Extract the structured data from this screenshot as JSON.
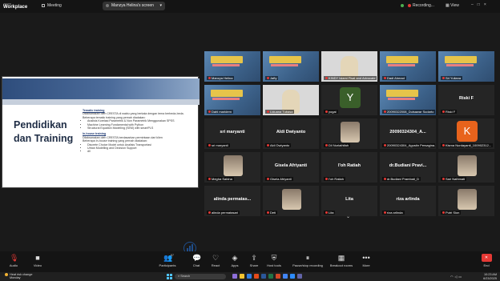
{
  "app": {
    "brand_small": "zoom",
    "brand_big": "Workplace",
    "meeting_label": "Meeting"
  },
  "sharing_banner": "Manzya Helina's screen",
  "recording_label": "Recording...",
  "view_label": "View",
  "slide": {
    "title_line1": "Pendidikan",
    "title_line2": "dan Training",
    "sections": [
      {
        "heading": "Tematic training",
        "intro": "Dilaksanakan oleh CRESTA di waktu yang berkala dengan tema berbeda-beda.",
        "intro2": "Beberapa tematic training yang pernah diadakan:",
        "items": [
          "Analisis Korelasi Parametrik & Non Parametrik Menggunakan SPSS",
          "Machine Learning Fundamental with Python",
          "Structural Equation Modelling (SEM) with smartPLS"
        ]
      },
      {
        "heading": "In-house training",
        "intro": "Dilaksanakan oleh CRESTA berdasarkan permintaan dari klien",
        "intro2": "Beberapa In-house training yang pernah diadakan:",
        "items": [
          "Discrete Choice Model untuk Analisis Transportasi",
          "Urban Modelling and Decision Support",
          "dll"
        ]
      }
    ],
    "logo_text": "CRESTA"
  },
  "participants": [
    {
      "name": "Manzya Helina",
      "kind": "poster"
    },
    {
      "name": "Jafty",
      "kind": "poster"
    },
    {
      "name": "KINDY Islami Fisal and Advocate",
      "kind": "face"
    },
    {
      "name": "Dadi Ahmad",
      "kind": "poster"
    },
    {
      "name": "Sri Yuliana",
      "kind": "poster"
    },
    {
      "name": "Dahl maridem",
      "kind": "poster"
    },
    {
      "name": "Liduana Tubasa",
      "kind": "face"
    },
    {
      "name": "yogai",
      "kind": "avatar",
      "avatar": "Y",
      "avatar_color": "y"
    },
    {
      "name": "20090322008_Dulsawar Sudarto",
      "kind": "poster"
    },
    {
      "name": "Riski F",
      "kind": "text",
      "big": "Riski F"
    },
    {
      "name": "sri maryanti",
      "kind": "text",
      "big": "sri maryanti"
    },
    {
      "name": "Aldi Dwiyanto",
      "kind": "text",
      "big": "Aldi Dwiyanto"
    },
    {
      "name": "Dil Nurlathifah",
      "kind": "pic"
    },
    {
      "name": "20090324304_Agustin Persagina...",
      "kind": "text",
      "big": "20090324304_A..."
    },
    {
      "name": "Kisma Nurdayanti_100902312...",
      "kind": "avatar",
      "avatar": "K",
      "avatar_color": "k"
    },
    {
      "name": "Megha Sabina",
      "kind": "pic"
    },
    {
      "name": "Gisela Afriyanti",
      "kind": "text",
      "big": "Gisela Afriyanti"
    },
    {
      "name": "I'oh Ratiah",
      "kind": "text",
      "big": "I'oh Ratiah"
    },
    {
      "name": "dr.Budiani Prambati_D",
      "kind": "text",
      "big": "dr.Budiani Pravi..."
    },
    {
      "name": "Sari Nathmati",
      "kind": "pic"
    },
    {
      "name": "alinda permatasari",
      "kind": "text",
      "big": "alinda permatas..."
    },
    {
      "name": "Deti",
      "kind": "pic"
    },
    {
      "name": "Lita",
      "kind": "text",
      "big": "Lita"
    },
    {
      "name": "riza arlinda",
      "kind": "text",
      "big": "riza arlinda"
    },
    {
      "name": "Putri Sion",
      "kind": "pic"
    }
  ],
  "toolbar": {
    "audio": "Audio",
    "video": "Video",
    "participants": "Participants",
    "participants_count": "57",
    "chat": "Chat",
    "react": "React",
    "apps": "Apps",
    "share": "Share",
    "host_tools": "Host tools",
    "pause_recording": "Pause/stop recording",
    "breakout_rooms": "Breakout rooms",
    "more": "More",
    "end": "End"
  },
  "taskbar": {
    "weather_line1": "Heat risk change",
    "weather_line2": "Monday",
    "search_placeholder": "Search",
    "time": "10:23 AM",
    "date": "6/23/2025"
  }
}
